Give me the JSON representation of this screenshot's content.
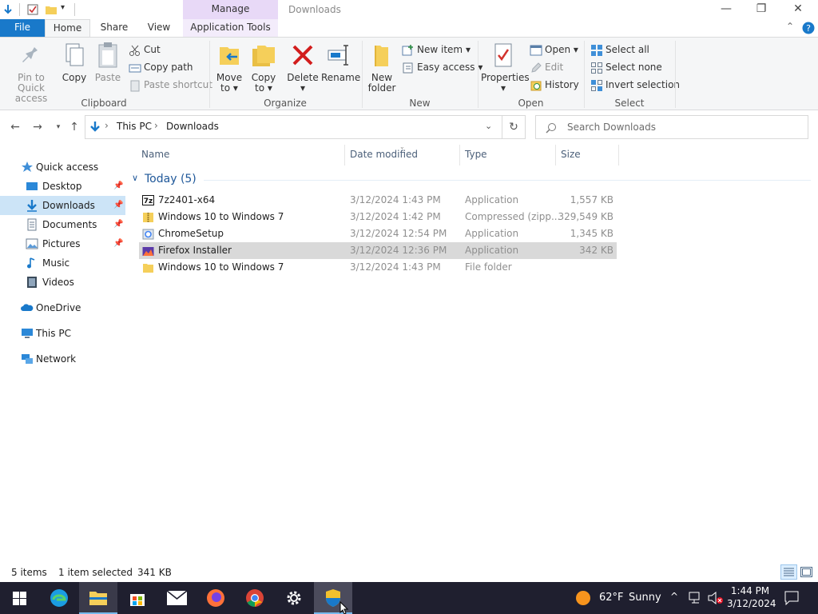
{
  "titlebar": {
    "manage_label": "Manage",
    "window_title": "Downloads",
    "minimize": "—",
    "restore": "❐",
    "close": "✕"
  },
  "ribbon_tabs": {
    "file": "File",
    "home": "Home",
    "share": "Share",
    "view": "View",
    "app_tools": "Application Tools"
  },
  "ribbon": {
    "clipboard": {
      "label": "Clipboard",
      "pin_line1": "Pin to Quick",
      "pin_line2": "access",
      "copy": "Copy",
      "paste": "Paste",
      "cut": "Cut",
      "copy_path": "Copy path",
      "paste_shortcut": "Paste shortcut"
    },
    "organize": {
      "label": "Organize",
      "move_line1": "Move",
      "move_line2": "to",
      "copy_line1": "Copy",
      "copy_line2": "to",
      "delete": "Delete",
      "rename": "Rename"
    },
    "new": {
      "label": "New",
      "folder_line1": "New",
      "folder_line2": "folder",
      "new_item": "New item",
      "easy_access": "Easy access"
    },
    "open": {
      "label": "Open",
      "properties": "Properties",
      "open": "Open",
      "edit": "Edit",
      "history": "History"
    },
    "select": {
      "label": "Select",
      "select_all": "Select all",
      "select_none": "Select none",
      "invert": "Invert selection"
    }
  },
  "address": {
    "crumb_1": "This PC",
    "crumb_2": "Downloads",
    "search_placeholder": "Search Downloads"
  },
  "nav": {
    "quick_access": "Quick access",
    "desktop": "Desktop",
    "downloads": "Downloads",
    "documents": "Documents",
    "pictures": "Pictures",
    "music": "Music",
    "videos": "Videos",
    "onedrive": "OneDrive",
    "this_pc": "This PC",
    "network": "Network"
  },
  "columns": {
    "name": "Name",
    "date": "Date modified",
    "type": "Type",
    "size": "Size"
  },
  "group_header": "Today (5)",
  "files": [
    {
      "name": "7z2401-x64",
      "date": "3/12/2024 1:43 PM",
      "type": "Application",
      "size": "1,557 KB",
      "icon": "7zip-icon"
    },
    {
      "name": "Windows 10 to Windows 7",
      "date": "3/12/2024 1:42 PM",
      "type": "Compressed (zipp...",
      "size": "329,549 KB",
      "icon": "zip-folder-icon"
    },
    {
      "name": "ChromeSetup",
      "date": "3/12/2024 12:54 PM",
      "type": "Application",
      "size": "1,345 KB",
      "icon": "chrome-setup-icon"
    },
    {
      "name": "Firefox Installer",
      "date": "3/12/2024 12:36 PM",
      "type": "Application",
      "size": "342 KB",
      "icon": "firefox-installer-icon",
      "selected": true
    },
    {
      "name": "Windows 10 to Windows 7",
      "date": "3/12/2024 1:43 PM",
      "type": "File folder",
      "size": "",
      "icon": "folder-icon"
    }
  ],
  "status": {
    "items": "5 items",
    "selected": "1 item selected",
    "size": "341 KB"
  },
  "taskbar": {
    "weather_temp": "62°F",
    "weather_cond": "Sunny",
    "time": "1:44 PM",
    "date": "3/12/2024"
  },
  "colors": {
    "file_tab": "#1979ca",
    "selection": "#d9d9d9",
    "taskbar": "#1f1f2f",
    "manage_tab": "#e8d9f7"
  }
}
